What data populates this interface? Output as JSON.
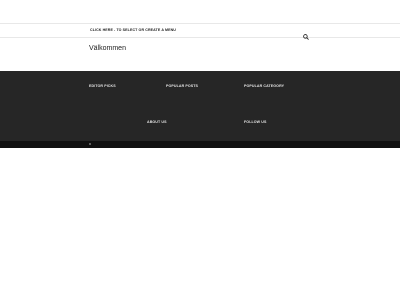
{
  "nav": {
    "menu_link": "CLICK HERE - TO SELECT OR CREATE A MENU",
    "search_icon": "search-icon"
  },
  "main": {
    "title": "Välkommen"
  },
  "footer": {
    "widgets": [
      {
        "heading": "EDITOR PICKS"
      },
      {
        "heading": "POPULAR POSTS"
      },
      {
        "heading": "POPULAR CATEGORY"
      },
      {
        "heading": "ABOUT US"
      },
      {
        "heading": "FOLLOW US"
      }
    ],
    "background": "#262626",
    "bottom_background": "#111111"
  }
}
